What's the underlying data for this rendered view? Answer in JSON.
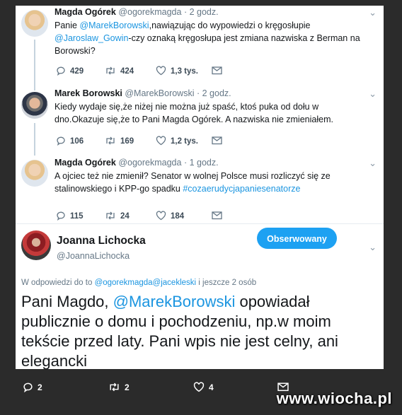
{
  "tweets": [
    {
      "name": "Magda Ogórek",
      "handle": "@ogorekmagda",
      "time": "· 2 godz.",
      "text_pre": "Panie ",
      "mention1": "@MarekBorowski",
      "text_mid": ",nawiązując do wypowiedzi o kręgosłupie ",
      "mention2": "@Jaroslaw_Gowin",
      "text_post": "-czy oznaką kręgosłupa jest zmiana nazwiska z Berman na Borowski?",
      "replies": "429",
      "retweets": "424",
      "likes": "1,3 tys."
    },
    {
      "name": "Marek Borowski",
      "handle": "@MarekBorowski",
      "time": "· 2 godz.",
      "text": "Kiedy wydaje się,że niżej nie można już spaść, ktoś puka od dołu w dno.Okazuje się,że to Pani Magda Ogórek. A nazwiska nie zmieniałem.",
      "replies": "106",
      "retweets": "169",
      "likes": "1,2 tys."
    },
    {
      "name": "Magda Ogórek",
      "handle": "@ogorekmagda",
      "time": "· 1 godz.",
      "text_pre": "A ojciec też nie zmienił? Senator w wolnej Polsce musi rozliczyć się ze stalinowskiego i KPP-go spadku ",
      "hashtag": "#cozaerudycjapaniesenatorze",
      "replies": "115",
      "retweets": "24",
      "likes": "184"
    }
  ],
  "main": {
    "name": "Joanna Lichocka",
    "handle": "@JoannaLichocka",
    "follow_label": "Obserwowany",
    "reply_prefix": "W odpowiedzi do to ",
    "reply_mentions": "@ogorekmagda@jacekleski",
    "reply_suffix": " i jeszcze 2 osób",
    "text_pre": "Pani Magdo, ",
    "mention": "@MarekBorowski",
    "text_post": " opowiadał publicznie o domu i pochodzeniu, np.w moim tekście przed laty. Pani wpis nie jest celny, ani elegancki",
    "replies": "2",
    "retweets": "2",
    "likes": "4"
  },
  "watermark": {
    "text": "www.wiocha.pl"
  },
  "colors": {
    "accent": "#1da1f2",
    "link": "#1b95e0",
    "background": "#2b2b2b"
  }
}
